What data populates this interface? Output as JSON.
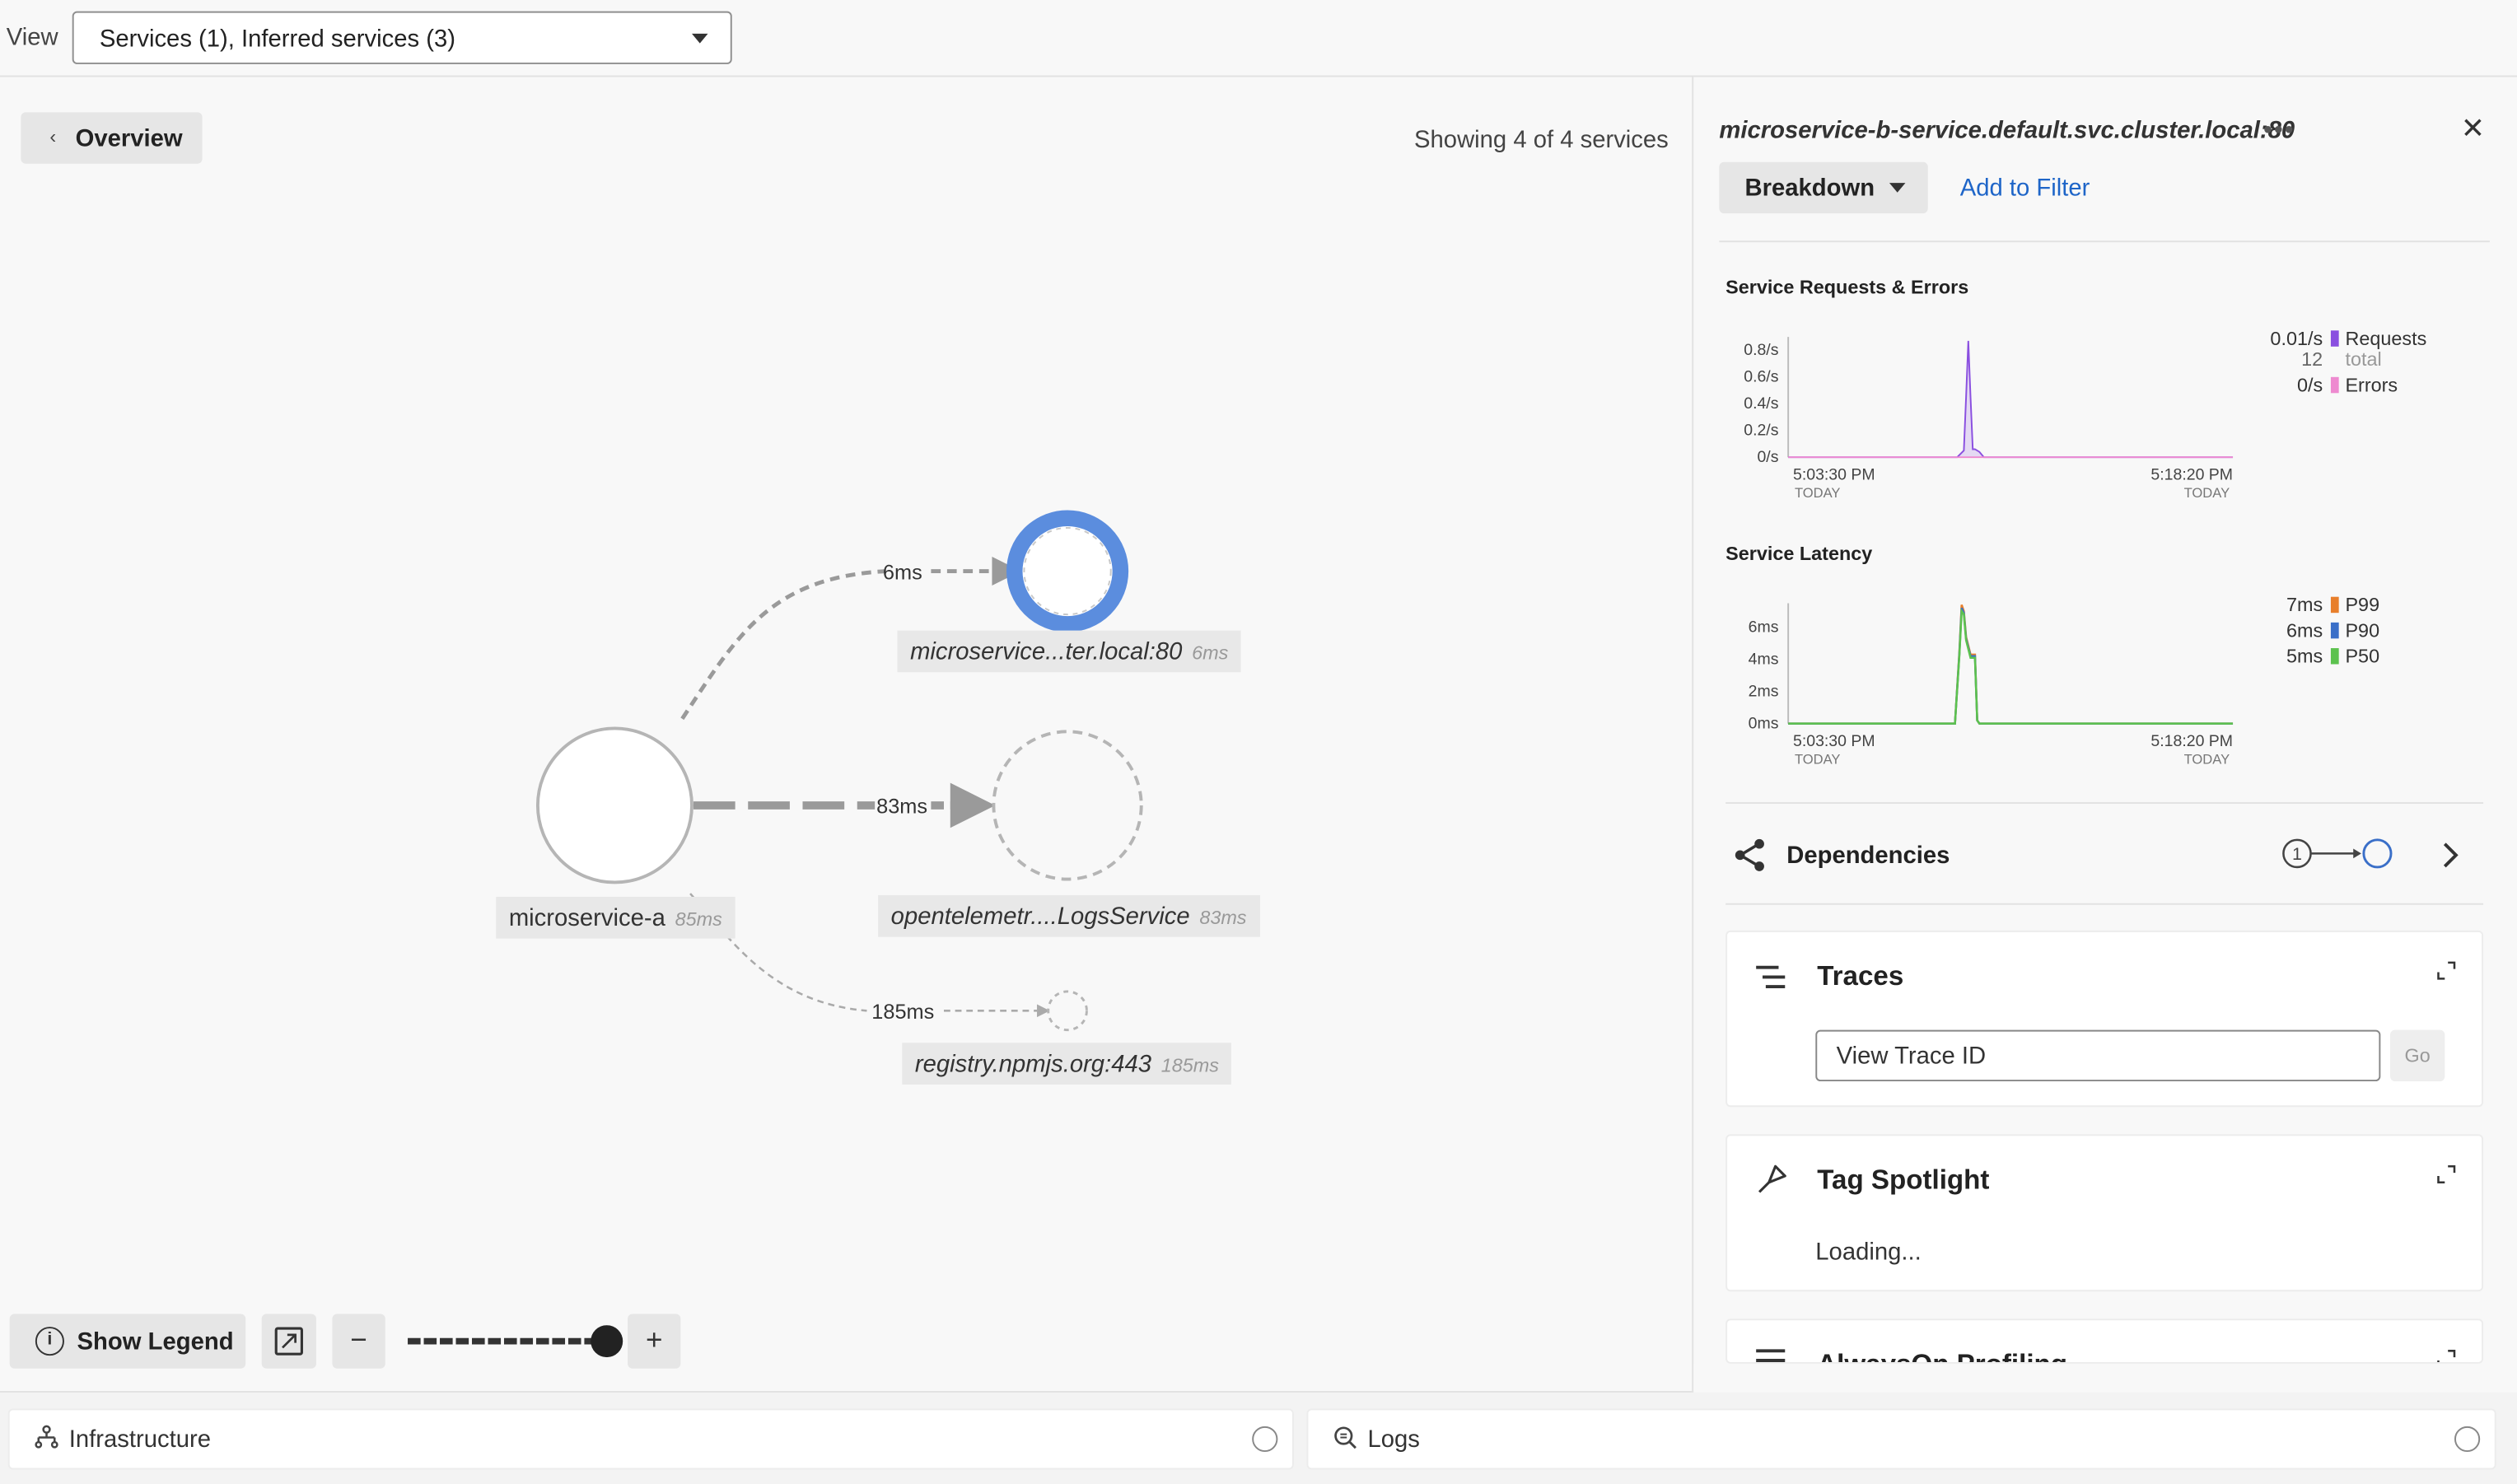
{
  "topbar": {
    "view_label": "View",
    "view_select_value": "Services (1), Inferred services (3)"
  },
  "map": {
    "overview_label": "Overview",
    "showing_text": "Showing 4 of 4 services",
    "nodes": [
      {
        "name": "microservice-a",
        "latency": "85ms",
        "italic": false
      },
      {
        "name": "microservice...ter.local:80",
        "latency": "6ms",
        "italic": true,
        "selected": true
      },
      {
        "name": "opentelemetr....LogsService",
        "latency": "83ms",
        "italic": true
      },
      {
        "name": "registry.npmjs.org:443",
        "latency": "185ms",
        "italic": true
      }
    ],
    "edges": [
      {
        "label": "6ms"
      },
      {
        "label": "83ms"
      },
      {
        "label": "185ms"
      }
    ],
    "controls": {
      "show_legend_label": "Show Legend",
      "zoom_out_label": "−",
      "zoom_in_label": "+",
      "zoom_level": 1.0
    }
  },
  "bottom": {
    "infrastructure_label": "Infrastructure",
    "logs_label": "Logs"
  },
  "side_panel": {
    "service_title": "microservice-b-service.default.svc.cluster.local:80",
    "more_icon": "ellipsis-icon",
    "close_icon": "close-icon",
    "breakdown_label": "Breakdown",
    "add_filter_label": "Add to Filter",
    "requests_errors": {
      "title": "Service Requests & Errors",
      "legend": [
        {
          "value": "0.01/s",
          "label": "Requests",
          "color": "#8a4fe0"
        },
        {
          "value": "12",
          "label": "total",
          "muted": true
        },
        {
          "value": "0/s",
          "label": "Errors",
          "color": "#ee8ad0"
        }
      ]
    },
    "latency": {
      "title": "Service Latency",
      "legend": [
        {
          "value": "7ms",
          "label": "P99",
          "color": "#e87f2b"
        },
        {
          "value": "6ms",
          "label": "P90",
          "color": "#3a6fc8"
        },
        {
          "value": "5ms",
          "label": "P50",
          "color": "#5cc24e"
        }
      ]
    },
    "dependencies": {
      "label": "Dependencies",
      "count": "1"
    },
    "traces": {
      "title": "Traces",
      "input_placeholder": "View Trace ID",
      "go_label": "Go"
    },
    "tag_spotlight": {
      "title": "Tag Spotlight",
      "status": "Loading..."
    },
    "profiling": {
      "title": "AlwaysOn Profiling"
    }
  },
  "chart_data": [
    {
      "type": "area",
      "title": "Service Requests & Errors",
      "x_labels": [
        "5:03:30 PM",
        "5:18:20 PM"
      ],
      "x_sublabels": [
        "TODAY",
        "TODAY"
      ],
      "y_ticks": [
        "0.8/s",
        "0.6/s",
        "0.4/s",
        "0.2/s",
        "0/s"
      ],
      "ylim": [
        0,
        0.9
      ],
      "x": [
        0,
        0.38,
        0.395,
        0.4,
        0.405,
        0.41,
        0.415,
        0.42,
        0.43,
        0.44,
        1
      ],
      "series": [
        {
          "name": "Requests",
          "color": "#8a4fe0",
          "values": [
            0,
            0,
            0.05,
            0.45,
            0.87,
            0.45,
            0.06,
            0.06,
            0.04,
            0,
            0
          ]
        },
        {
          "name": "Errors",
          "color": "#ee8ad0",
          "values": [
            0,
            0,
            0,
            0,
            0,
            0,
            0,
            0,
            0,
            0,
            0
          ]
        }
      ]
    },
    {
      "type": "line",
      "title": "Service Latency",
      "x_labels": [
        "5:03:30 PM",
        "5:18:20 PM"
      ],
      "x_sublabels": [
        "TODAY",
        "TODAY"
      ],
      "y_ticks": [
        "6ms",
        "4ms",
        "2ms",
        "0ms"
      ],
      "ylim": [
        0,
        7.5
      ],
      "x": [
        0,
        0.375,
        0.385,
        0.39,
        0.395,
        0.4,
        0.41,
        0.42,
        0.425,
        0.43,
        1
      ],
      "series": [
        {
          "name": "P99",
          "color": "#e87f2b",
          "values": [
            0,
            0,
            4.5,
            7.4,
            7.0,
            5.4,
            4.3,
            4.3,
            0.2,
            0,
            0
          ]
        },
        {
          "name": "P90",
          "color": "#3a6fc8",
          "values": [
            0,
            0,
            4.4,
            7.2,
            6.9,
            5.3,
            4.2,
            4.2,
            0.2,
            0,
            0
          ]
        },
        {
          "name": "P50",
          "color": "#5cc24e",
          "values": [
            0,
            0,
            4.3,
            7.0,
            6.8,
            5.2,
            4.1,
            4.1,
            0.2,
            0,
            0
          ]
        }
      ]
    }
  ]
}
